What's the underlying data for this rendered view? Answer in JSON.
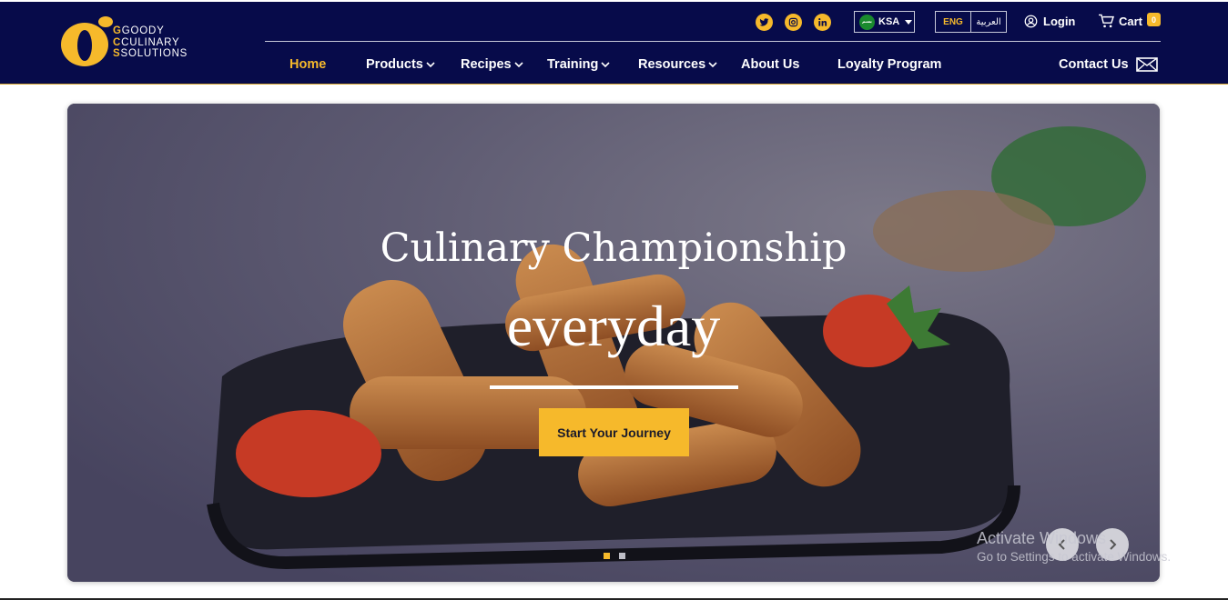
{
  "brand": {
    "name_line1": "GOODY",
    "name_line2": "CULINARY",
    "name_line3": "SOLUTIONS",
    "colors": {
      "navy": "#070b4a",
      "accent": "#f6b92b"
    }
  },
  "topbar": {
    "social_icons": [
      "twitter-icon",
      "instagram-icon",
      "linkedin-icon"
    ],
    "country": "KSA",
    "flag_text": "بسم",
    "lang_en": "ENG",
    "lang_ar": "العربية",
    "login": "Login",
    "cart": "Cart",
    "cart_count": "0"
  },
  "nav": {
    "items": [
      {
        "label": "Home",
        "active": true,
        "dropdown": false
      },
      {
        "label": "Products",
        "dropdown": true
      },
      {
        "label": "Recipes",
        "dropdown": true
      },
      {
        "label": "Training",
        "dropdown": true
      },
      {
        "label": "Resources",
        "dropdown": true
      },
      {
        "label": "About Us",
        "dropdown": false
      },
      {
        "label": "Loyalty Program",
        "dropdown": false
      }
    ],
    "contact": "Contact Us"
  },
  "hero": {
    "title": "Culinary Championship",
    "subtitle": "everyday",
    "cta": "Start Your Journey",
    "slide_count": 2,
    "active_slide": 1
  },
  "watermark": {
    "line1": "Activate Windows",
    "line2": "Go to Settings to activate Windows."
  }
}
